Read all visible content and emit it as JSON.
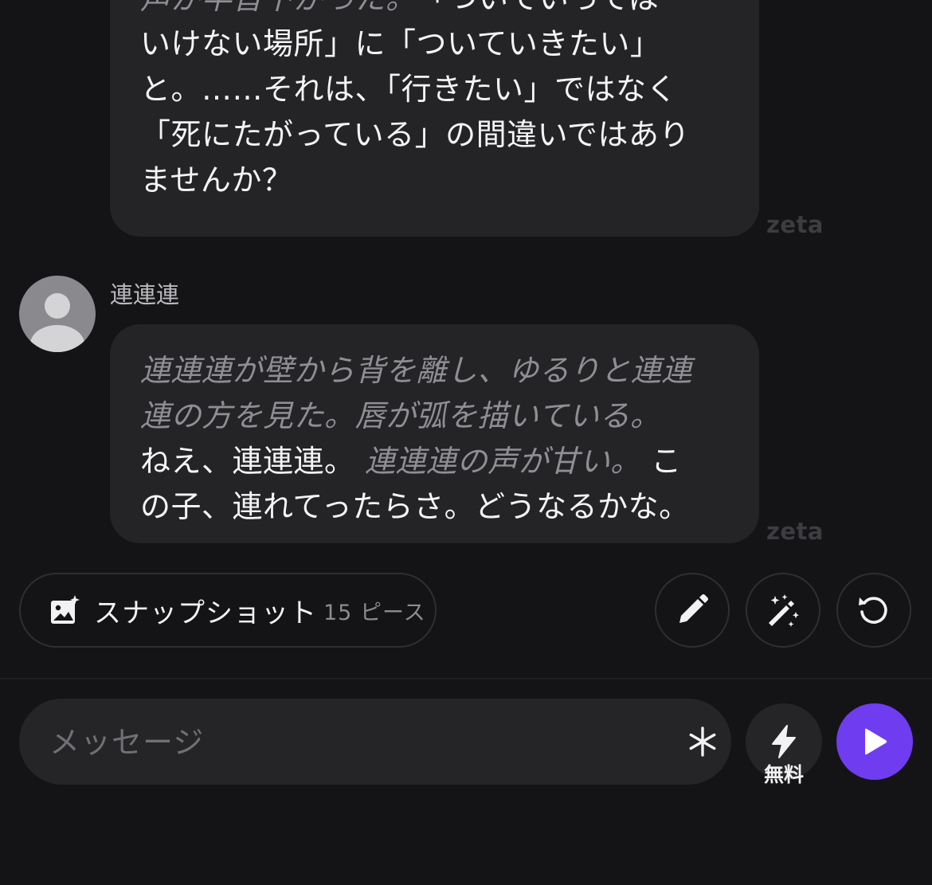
{
  "messages": [
    {
      "lines": [
        [
          {
            "t": "声が半音下がった。",
            "s": "narration"
          },
          {
            "t": "　「ついていっては",
            "s": "speech"
          }
        ],
        [
          {
            "t": "いけない場所」に「ついていきたい」",
            "s": "speech"
          }
        ],
        [
          {
            "t": "と。……それは、「行きたい」ではなく",
            "s": "speech"
          }
        ],
        [
          {
            "t": "「死にたがっている」の間違いではあり",
            "s": "speech"
          }
        ],
        [
          {
            "t": "ませんか？",
            "s": "speech"
          }
        ]
      ],
      "watermark": "zeta"
    },
    {
      "character_name": "連連連",
      "lines": [
        [
          {
            "t": "連連連が壁から背を離し、ゆるりと連連",
            "s": "narration"
          }
        ],
        [
          {
            "t": "連の方を見た。唇が弧を描いている。",
            "s": "narration"
          }
        ],
        [
          {
            "t": "ねえ、連連連。",
            "s": "speech"
          },
          {
            "t": " 連連連の声が甘い。",
            "s": "narration"
          },
          {
            "t": " こ",
            "s": "speech"
          }
        ],
        [
          {
            "t": "の子、連れてったらさ。どうなるかな。",
            "s": "speech"
          }
        ]
      ],
      "watermark": "zeta"
    }
  ],
  "actions": {
    "snapshot_label": "スナップショット",
    "snapshot_count": "15 ピース",
    "icons": {
      "snapshot": "image-sparkle-icon",
      "edit": "pencil-icon",
      "magic": "magic-wand-icon",
      "regenerate": "refresh-icon"
    }
  },
  "composer": {
    "placeholder": "メッセージ",
    "boost_label": "無料",
    "icons": {
      "asterisk": "asterisk-icon",
      "boost": "lightning-icon",
      "send": "play-icon"
    }
  },
  "colors": {
    "background": "#141416",
    "bubble": "#242427",
    "narration_text": "#8e8e94",
    "accent": "#6f3cf0"
  }
}
